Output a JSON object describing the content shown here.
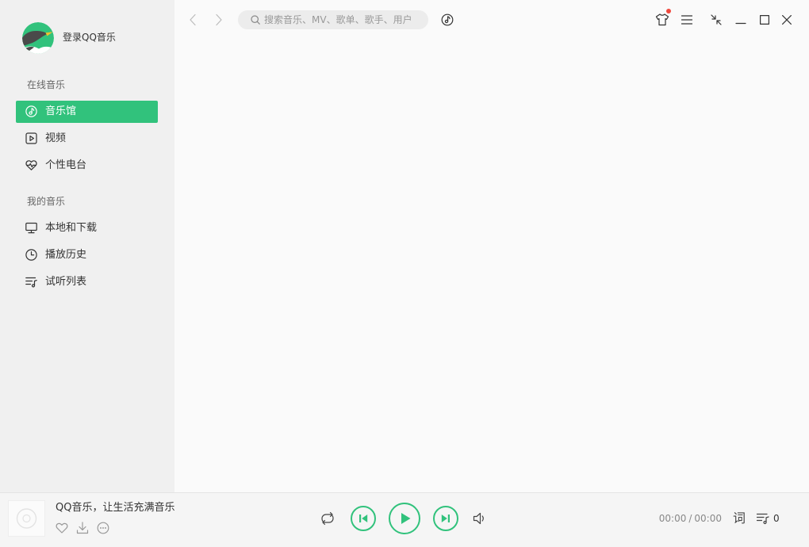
{
  "theme": {
    "accent": "#31c27c",
    "badge": "#f0493e",
    "sidebar_bg": "#f0f0f0",
    "main_bg": "#fafafa"
  },
  "user": {
    "login_label": "登录QQ音乐",
    "avatar_icon": "penguin-avatar-icon"
  },
  "sidebar": {
    "online_music": {
      "title": "在线音乐",
      "items": [
        {
          "label": "音乐馆",
          "icon": "music-hall-icon",
          "active": true
        },
        {
          "label": "视频",
          "icon": "video-icon",
          "active": false
        },
        {
          "label": "个性电台",
          "icon": "radio-heart-icon",
          "active": false
        }
      ]
    },
    "my_music": {
      "title": "我的音乐",
      "items": [
        {
          "label": "本地和下载",
          "icon": "monitor-icon",
          "active": false
        },
        {
          "label": "播放历史",
          "icon": "clock-icon",
          "active": false
        },
        {
          "label": "试听列表",
          "icon": "playlist-icon",
          "active": false
        }
      ]
    }
  },
  "toolbar": {
    "search": {
      "placeholder": "搜索音乐、MV、歌单、歌手、用户",
      "value": ""
    },
    "icons": [
      "back-icon",
      "forward-icon",
      "search-icon",
      "music-recognition-icon",
      "skin-icon",
      "menu-icon",
      "mini-mode-icon",
      "minimize-icon",
      "maximize-icon",
      "close-icon"
    ],
    "skin_has_notification": true
  },
  "player": {
    "song_title": "QQ音乐，让生活充满音乐",
    "time": {
      "current": "00:00",
      "separator": "/",
      "total": "00:00"
    },
    "lyrics_label": "词",
    "playlist_count": "0",
    "icons": [
      "album-placeholder-icon",
      "heart-icon",
      "download-icon",
      "more-icon",
      "loop-icon",
      "previous-icon",
      "play-icon",
      "next-icon",
      "volume-icon",
      "playlist-icon"
    ]
  }
}
